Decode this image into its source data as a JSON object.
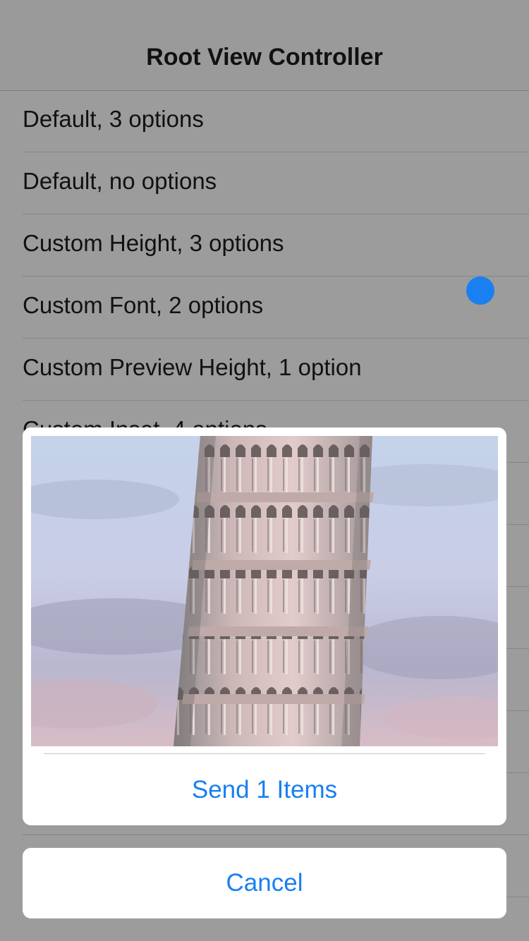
{
  "navbar": {
    "title": "Root View Controller"
  },
  "list": {
    "items": [
      {
        "label": "Default, 3 options"
      },
      {
        "label": "Default, no options"
      },
      {
        "label": "Custom Height, 3 options"
      },
      {
        "label": "Custom Font, 2 options"
      },
      {
        "label": "Custom Preview Height, 1 option"
      },
      {
        "label": "Custom Inset, 4 options"
      },
      {
        "label": ""
      },
      {
        "label": ""
      },
      {
        "label": ""
      },
      {
        "label": ""
      },
      {
        "label": ""
      },
      {
        "label": ""
      },
      {
        "label": ""
      }
    ]
  },
  "action_sheet": {
    "preview_icon": "photo-leaning-tower",
    "send_label": "Send 1 Items",
    "cancel_label": "Cancel"
  },
  "colors": {
    "accent": "#1a7ff0",
    "dim_background": "#9c9c9c",
    "sheet_background": "#ffffff"
  }
}
